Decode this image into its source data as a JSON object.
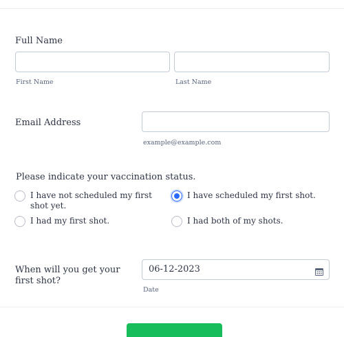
{
  "full_name": {
    "label": "Full Name",
    "first_sublabel": "First Name",
    "last_sublabel": "Last Name",
    "first_value": "",
    "last_value": ""
  },
  "email": {
    "label": "Email Address",
    "sublabel": "example@example.com",
    "value": ""
  },
  "vaccination": {
    "question": "Please indicate your vaccination status.",
    "options": [
      {
        "label": "I have not scheduled my first shot yet.",
        "checked": false
      },
      {
        "label": "I have scheduled my first shot.",
        "checked": true
      },
      {
        "label": "I had my first shot.",
        "checked": false
      },
      {
        "label": "I had both of my shots.",
        "checked": false
      }
    ]
  },
  "date": {
    "label": "When will you get your first shot?",
    "value": "06-12-2023",
    "sublabel": "Date",
    "icon": "calendar-icon"
  },
  "colors": {
    "accent": "#2e69ff",
    "submit": "#18bd5b"
  }
}
